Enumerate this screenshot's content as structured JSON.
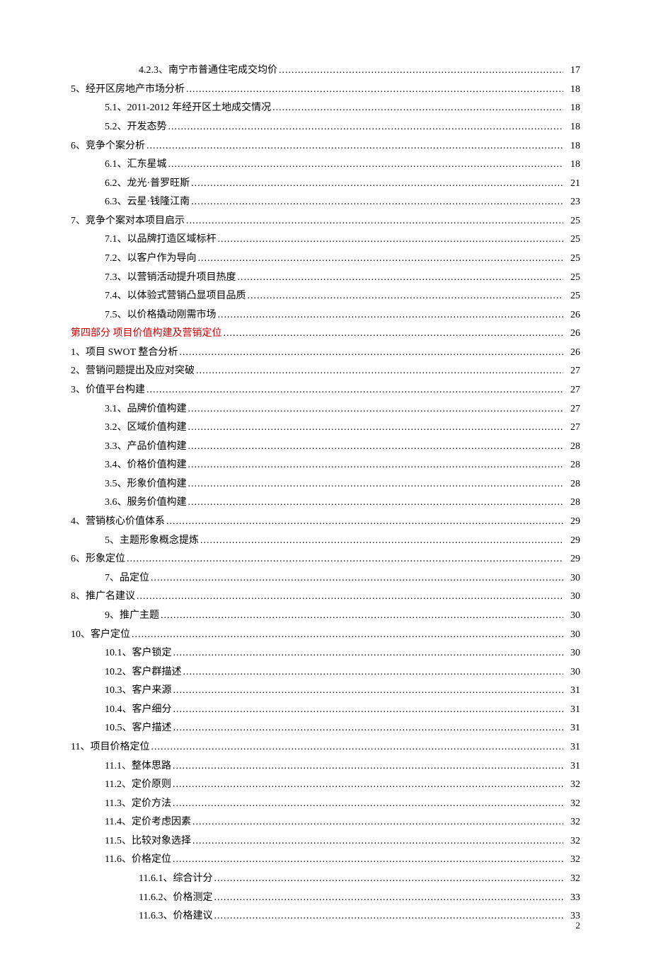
{
  "page_number": "2",
  "toc": [
    {
      "level": 3,
      "text": "4.2.3、南宁市普通住宅成交均价",
      "page": "17",
      "red": false
    },
    {
      "level": 1,
      "text": "5、经开区房地产市场分析",
      "page": "18",
      "red": false
    },
    {
      "level": 2,
      "text": "5.1、2011-2012 年经开区土地成交情况",
      "page": "18",
      "red": false
    },
    {
      "level": 2,
      "text": "5.2、开发态势",
      "page": "18",
      "red": false
    },
    {
      "level": 1,
      "text": "6、竞争个案分析",
      "page": "18",
      "red": false
    },
    {
      "level": 2,
      "text": "6.1、汇东星城",
      "page": "18",
      "red": false
    },
    {
      "level": 2,
      "text": "6.2、龙光·普罗旺斯",
      "page": "21",
      "red": false
    },
    {
      "level": 2,
      "text": "6.3、云星·钱隆江南",
      "page": "23",
      "red": false
    },
    {
      "level": 1,
      "text": "7、竞争个案对本项目启示",
      "page": "25",
      "red": false
    },
    {
      "level": 2,
      "text": "7.1、以品牌打造区域标杆",
      "page": "25",
      "red": false
    },
    {
      "level": 2,
      "text": "7.2、以客户作为导向",
      "page": "25",
      "red": false
    },
    {
      "level": 2,
      "text": "7.3、以营销活动提升项目热度",
      "page": "25",
      "red": false
    },
    {
      "level": 2,
      "text": "7.4、以体验式营销凸显项目品质",
      "page": "25",
      "red": false
    },
    {
      "level": 2,
      "text": "7.5、以价格撬动刚需市场",
      "page": "26",
      "red": false
    },
    {
      "level": 1,
      "text": "第四部分 项目价值构建及营销定位",
      "page": "26",
      "red": true
    },
    {
      "level": 1,
      "text": "1、项目 SWOT 整合分析",
      "page": "26",
      "red": false
    },
    {
      "level": 1,
      "text": "2、营销问题提出及应对突破",
      "page": "27",
      "red": false
    },
    {
      "level": 1,
      "text": "3、价值平台构建",
      "page": "27",
      "red": false
    },
    {
      "level": 2,
      "text": "3.1、品牌价值构建",
      "page": "27",
      "red": false
    },
    {
      "level": 2,
      "text": "3.2、区域价值构建",
      "page": "27",
      "red": false
    },
    {
      "level": 2,
      "text": "3.3、产品价值构建",
      "page": "28",
      "red": false
    },
    {
      "level": 2,
      "text": "3.4、价格价值构建",
      "page": "28",
      "red": false
    },
    {
      "level": 2,
      "text": "3.5、形象价值构建",
      "page": "28",
      "red": false
    },
    {
      "level": 2,
      "text": "3.6、服务价值构建",
      "page": "28",
      "red": false
    },
    {
      "level": 1,
      "text": "4、营销核心价值体系",
      "page": "29",
      "red": false
    },
    {
      "level": 2,
      "text": "5、主题形象概念提炼",
      "page": "29",
      "red": false
    },
    {
      "level": 1,
      "text": "6、形象定位",
      "page": "29",
      "red": false
    },
    {
      "level": 2,
      "text": "7、品定位",
      "page": "30",
      "red": false
    },
    {
      "level": 1,
      "text": "8、推广名建议",
      "page": "30",
      "red": false
    },
    {
      "level": 2,
      "text": "9、推广主题",
      "page": "30",
      "red": false
    },
    {
      "level": 1,
      "text": "10、客户定位",
      "page": "30",
      "red": false
    },
    {
      "level": 2,
      "text": "10.1、客户锁定",
      "page": "30",
      "red": false
    },
    {
      "level": 2,
      "text": "10.2、客户群描述",
      "page": "30",
      "red": false
    },
    {
      "level": 2,
      "text": "10.3、客户来源",
      "page": "31",
      "red": false
    },
    {
      "level": 2,
      "text": "10.4、客户细分",
      "page": "31",
      "red": false
    },
    {
      "level": 2,
      "text": "10.5、客户描述",
      "page": "31",
      "red": false
    },
    {
      "level": 1,
      "text": "11、项目价格定位",
      "page": "31",
      "red": false
    },
    {
      "level": 2,
      "text": "11.1、整体思路",
      "page": "31",
      "red": false
    },
    {
      "level": 2,
      "text": "11.2、定价原则",
      "page": "32",
      "red": false
    },
    {
      "level": 2,
      "text": "11.3、定价方法",
      "page": "32",
      "red": false
    },
    {
      "level": 2,
      "text": "11.4、定价考虑因素",
      "page": "32",
      "red": false
    },
    {
      "level": 2,
      "text": "11.5、比较对象选择",
      "page": "32",
      "red": false
    },
    {
      "level": 2,
      "text": "11.6、价格定位",
      "page": "32",
      "red": false
    },
    {
      "level": 3,
      "text": "11.6.1、综合计分",
      "page": "32",
      "red": false
    },
    {
      "level": 3,
      "text": "11.6.2、价格测定",
      "page": "33",
      "red": false
    },
    {
      "level": 3,
      "text": "11.6.3、价格建议",
      "page": "33",
      "red": false
    }
  ]
}
